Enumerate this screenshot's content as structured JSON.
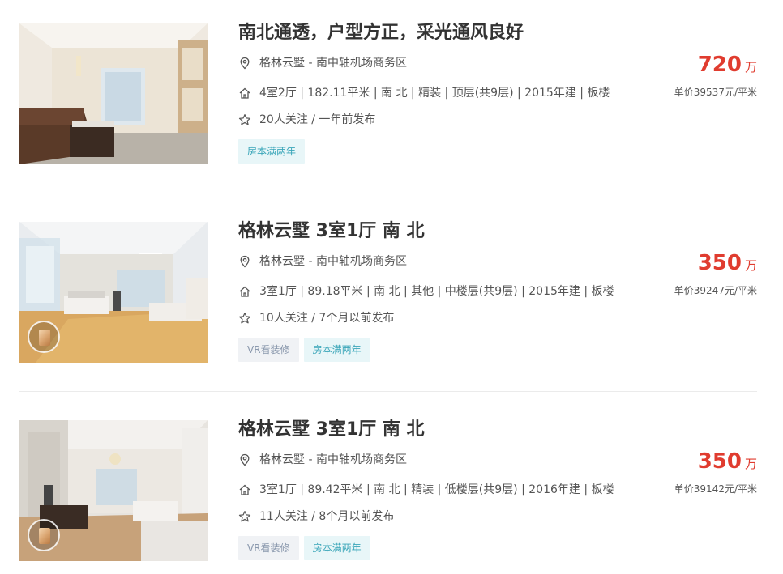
{
  "listings": [
    {
      "title": "南北通透，户型方正，采光通风良好",
      "address": "格林云墅 - 南中轴机场商务区",
      "house_info": "4室2厅 | 182.11平米 | 南 北 | 精装 | 顶层(共9层) | 2015年建 | 板楼",
      "follow_info": "20人关注 / 一年前发布",
      "tags": [
        "房本满两年"
      ],
      "total_price": "720",
      "total_unit": "万",
      "unit_price": "单价39537元/平米",
      "has_vr": false
    },
    {
      "title": "格林云墅 3室1厅 南 北",
      "address": "格林云墅 - 南中轴机场商务区",
      "house_info": "3室1厅 | 89.18平米 | 南 北 | 其他 | 中楼层(共9层) | 2015年建 | 板楼",
      "follow_info": "10人关注 / 7个月以前发布",
      "tags": [
        "VR看装修",
        "房本满两年"
      ],
      "total_price": "350",
      "total_unit": "万",
      "unit_price": "单价39247元/平米",
      "has_vr": true
    },
    {
      "title": "格林云墅 3室1厅 南 北",
      "address": "格林云墅 - 南中轴机场商务区",
      "house_info": "3室1厅 | 89.42平米 | 南 北 | 精装 | 低楼层(共9层) | 2016年建 | 板楼",
      "follow_info": "11人关注 / 8个月以前发布",
      "tags": [
        "VR看装修",
        "房本满两年"
      ],
      "total_price": "350",
      "total_unit": "万",
      "unit_price": "单价39142元/平米",
      "has_vr": true
    }
  ],
  "icons": {
    "address": "location-pin-icon",
    "house": "house-icon",
    "follow": "star-icon",
    "vr": "vr-cube-icon"
  },
  "colors": {
    "price": "#e03c2f",
    "tag_vr_bg": "#f0f2f5",
    "tag_vr_text": "#8a98ad",
    "tag_taxfree_bg": "#e8f6f8",
    "tag_taxfree_text": "#3aa6b9"
  }
}
